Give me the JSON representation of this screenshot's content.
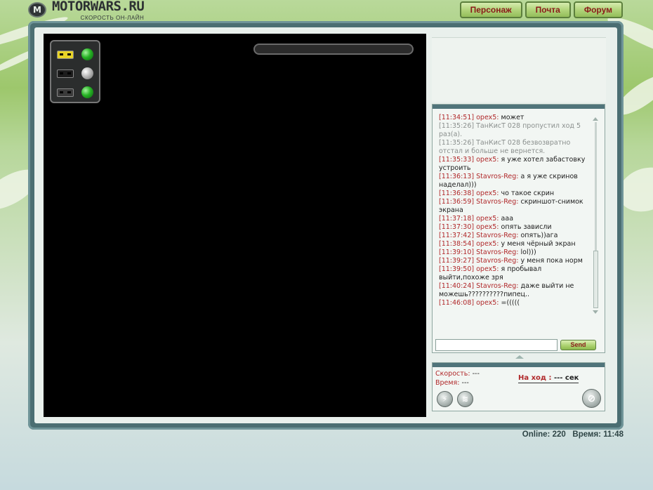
{
  "header": {
    "logo_mark": "M",
    "logo_title": "MOTORWARS.RU",
    "logo_subtitle": "СКОРОСТЬ ОН-ЛАЙН"
  },
  "topnav": [
    {
      "label": "Персонаж"
    },
    {
      "label": "Почта"
    },
    {
      "label": "Форум"
    }
  ],
  "game": {
    "players": [
      {
        "car_color": "#e8d327",
        "status": "green"
      },
      {
        "car_color": "#1c1c1c",
        "status": "grey"
      },
      {
        "car_color": "#3a3a3a",
        "status": "green"
      }
    ]
  },
  "chat": {
    "messages": [
      {
        "time": "[11:34:51]",
        "user": "opex5:",
        "text": "может",
        "system": false
      },
      {
        "time": "[11:35:26]",
        "user": "",
        "text": "ТанКисТ 028 пропустил ход 5 раз(а).",
        "system": true
      },
      {
        "time": "[11:35:26]",
        "user": "",
        "text": "ТанКисТ 028 безвозвратно отстал и больше не вернется.",
        "system": true
      },
      {
        "time": "[11:35:33]",
        "user": "opex5:",
        "text": "я уже хотел забастовку устроить",
        "system": false
      },
      {
        "time": "[11:36:13]",
        "user": "Stavros-Reg:",
        "text": "а я уже скринов наделал)))",
        "system": false
      },
      {
        "time": "[11:36:38]",
        "user": "opex5:",
        "text": "чо такое скрин",
        "system": false
      },
      {
        "time": "[11:36:59]",
        "user": "Stavros-Reg:",
        "text": "скриншот-снимок экрана",
        "system": false
      },
      {
        "time": "[11:37:18]",
        "user": "opex5:",
        "text": "ааа",
        "system": false
      },
      {
        "time": "[11:37:30]",
        "user": "opex5:",
        "text": "опять зависли",
        "system": false
      },
      {
        "time": "[11:37:42]",
        "user": "Stavros-Reg:",
        "text": "опять))ага",
        "system": false
      },
      {
        "time": "[11:38:54]",
        "user": "opex5:",
        "text": "у меня чёрный экран",
        "system": false
      },
      {
        "time": "[11:39:10]",
        "user": "Stavros-Reg:",
        "text": "lol)))",
        "system": false
      },
      {
        "time": "[11:39:27]",
        "user": "Stavros-Reg:",
        "text": "у меня пока норм",
        "system": false
      },
      {
        "time": "[11:39:50]",
        "user": "opex5:",
        "text": "я пробывал выйти,похоже зря",
        "system": false
      },
      {
        "time": "[11:40:24]",
        "user": "Stavros-Reg:",
        "text": "даже выйти не можешь??????????пипец..",
        "system": false
      },
      {
        "time": "[11:46:08]",
        "user": "opex5:",
        "text": "=(((((",
        "system": false
      }
    ],
    "input_value": "",
    "send_label": "Send"
  },
  "status": {
    "speed_label": "Скорость:",
    "speed_value": "---",
    "time_label": "Время:",
    "time_value": "---",
    "turn_label": "На ход :",
    "turn_value": "--- сек"
  },
  "footer": {
    "online_label": "Online:",
    "online_value": "220",
    "time_label": "Время:",
    "time_value": "11:48"
  }
}
